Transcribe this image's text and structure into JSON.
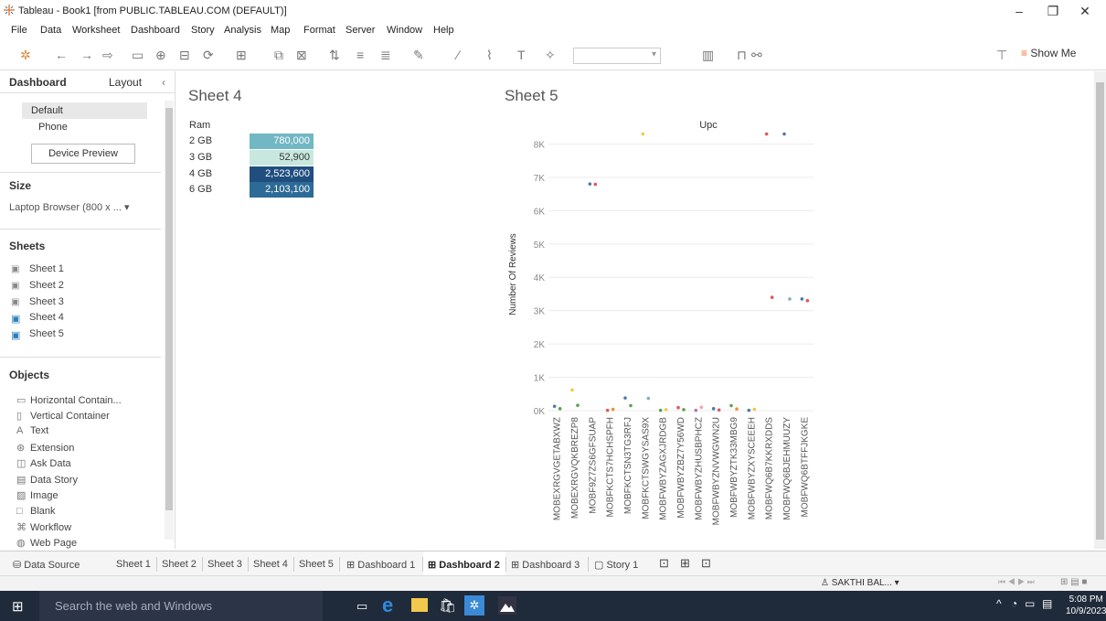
{
  "window": {
    "title": "Tableau - Book1 [from PUBLIC.TABLEAU.COM (DEFAULT)]",
    "minimize": "–",
    "maximize": "❐",
    "close": "✕"
  },
  "menu": [
    "File",
    "Data",
    "Worksheet",
    "Dashboard",
    "Story",
    "Analysis",
    "Map",
    "Format",
    "Server",
    "Window",
    "Help"
  ],
  "toolbar": {
    "show_me": "Show Me"
  },
  "left_panel": {
    "tabs": [
      "Dashboard",
      "Layout"
    ],
    "device_layouts": [
      "Default",
      "Phone"
    ],
    "device_preview_button": "Device Preview",
    "size_heading": "Size",
    "size_value": "Laptop Browser (800 x ...",
    "sheets_heading": "Sheets",
    "sheets": [
      "Sheet 1",
      "Sheet 2",
      "Sheet 3",
      "Sheet 4",
      "Sheet 5"
    ],
    "objects_heading": "Objects",
    "objects": [
      {
        "label": "Horizontal Contain...",
        "icon": "horizontal-container-icon"
      },
      {
        "label": "Vertical Container",
        "icon": "vertical-container-icon"
      },
      {
        "label": "Text",
        "icon": "text-icon"
      },
      {
        "label": "Extension",
        "icon": "extension-icon"
      },
      {
        "label": "Ask Data",
        "icon": "ask-data-icon"
      },
      {
        "label": "Data Story",
        "icon": "data-story-icon"
      },
      {
        "label": "Image",
        "icon": "image-icon"
      },
      {
        "label": "Blank",
        "icon": "blank-icon"
      },
      {
        "label": "Workflow",
        "icon": "workflow-icon"
      },
      {
        "label": "Web Page",
        "icon": "web-page-icon"
      }
    ]
  },
  "sheet4": {
    "title": "Sheet 4",
    "column_header": "Ram",
    "rows": [
      {
        "label": "2 GB",
        "value": "780,000",
        "color": "#72b7c4"
      },
      {
        "label": "3 GB",
        "value": "52,900",
        "color": "#c8e8df"
      },
      {
        "label": "4 GB",
        "value": "2,523,600",
        "color": "#1f4e7f"
      },
      {
        "label": "6 GB",
        "value": "2,103,100",
        "color": "#2c6a97"
      }
    ]
  },
  "sheet5": {
    "title": "Sheet 5"
  },
  "chart_data": {
    "type": "scatter",
    "title": "Upc",
    "ylabel": "Number Of Reviews",
    "ylim": [
      0,
      9000
    ],
    "yticks": [
      "0K",
      "1K",
      "2K",
      "3K",
      "4K",
      "5K",
      "6K",
      "7K",
      "8K"
    ],
    "categories": [
      "MOBEXRGVGETABXWZ",
      "MOBEXRGVQKBREZP8",
      "MOBF9Z7ZS6GFSUAP",
      "MOBFKCTS7HCHSPFH",
      "MOBFKCTSN3TG3RFJ",
      "MOBFKCTSWGYSAS9X",
      "MOBFWBYZAGXJRDGB",
      "MOBFWBYZBZ7Y56WD",
      "MOBFWBYZHUSBPHCZ",
      "MOBFWBYZNVWGWN2U",
      "MOBFWBYZTK33MBG9",
      "MOBFWBYZXYSCEEEH",
      "MOBFWQ6B7KKRXDDS",
      "MOBFWQ6BJEHMUUZY",
      "MOBFWQ6BTFFJKGKE"
    ],
    "points": [
      {
        "cat": 0,
        "y": 130,
        "color": "#4e79a7"
      },
      {
        "cat": 0,
        "y": 60,
        "color": "#59a14f"
      },
      {
        "cat": 1,
        "y": 620,
        "color": "#edc948"
      },
      {
        "cat": 1,
        "y": 160,
        "color": "#59a14f"
      },
      {
        "cat": 2,
        "y": 6800,
        "color": "#4e79a7"
      },
      {
        "cat": 2,
        "y": 6790,
        "color": "#e15759"
      },
      {
        "cat": 3,
        "y": 10,
        "color": "#e15759"
      },
      {
        "cat": 3,
        "y": 40,
        "color": "#f28e2b"
      },
      {
        "cat": 4,
        "y": 380,
        "color": "#4e79a7"
      },
      {
        "cat": 4,
        "y": 150,
        "color": "#59a14f"
      },
      {
        "cat": 5,
        "y": 8300,
        "color": "#edc948"
      },
      {
        "cat": 5,
        "y": 370,
        "color": "#76b7b2"
      },
      {
        "cat": 6,
        "y": 10,
        "color": "#59a14f"
      },
      {
        "cat": 6,
        "y": 30,
        "color": "#edc948"
      },
      {
        "cat": 7,
        "y": 90,
        "color": "#e15759"
      },
      {
        "cat": 7,
        "y": 30,
        "color": "#59a14f"
      },
      {
        "cat": 8,
        "y": 10,
        "color": "#af7aa1"
      },
      {
        "cat": 8,
        "y": 100,
        "color": "#ff9da7"
      },
      {
        "cat": 9,
        "y": 60,
        "color": "#4e79a7"
      },
      {
        "cat": 9,
        "y": 20,
        "color": "#e15759"
      },
      {
        "cat": 10,
        "y": 150,
        "color": "#59a14f"
      },
      {
        "cat": 10,
        "y": 50,
        "color": "#f28e2b"
      },
      {
        "cat": 11,
        "y": 10,
        "color": "#4e79a7"
      },
      {
        "cat": 11,
        "y": 40,
        "color": "#edc948"
      },
      {
        "cat": 12,
        "y": 8300,
        "color": "#e15759"
      },
      {
        "cat": 12,
        "y": 3400,
        "color": "#e15759"
      },
      {
        "cat": 13,
        "y": 8300,
        "color": "#4e79a7"
      },
      {
        "cat": 13,
        "y": 3350,
        "color": "#76b7b2"
      },
      {
        "cat": 14,
        "y": 3350,
        "color": "#4e79a7"
      },
      {
        "cat": 14,
        "y": 3300,
        "color": "#e15759"
      }
    ]
  },
  "bottom_tabs": [
    "Data Source",
    "Sheet 1",
    "Sheet 2",
    "Sheet 3",
    "Sheet 4",
    "Sheet 5",
    "Dashboard 1",
    "Dashboard 2",
    "Dashboard 3",
    "Story 1"
  ],
  "active_tab": "Dashboard 2",
  "status": {
    "user": "SAKTHI BAL..."
  },
  "taskbar": {
    "search_placeholder": "Search the web and Windows",
    "time": "5:08 PM",
    "date": "10/9/2023"
  }
}
